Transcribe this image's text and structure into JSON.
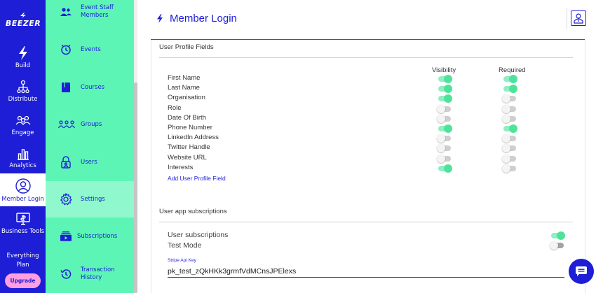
{
  "brand": {
    "logo_text": "BEEZER"
  },
  "rail": {
    "items": [
      {
        "label": "Build",
        "icon": "bolt-icon"
      },
      {
        "label": "Distribute",
        "icon": "distribute-icon"
      },
      {
        "label": "Engage",
        "icon": "engage-icon"
      },
      {
        "label": "Analytics",
        "icon": "analytics-icon"
      },
      {
        "label": "Member Login",
        "icon": "member-login-icon",
        "active": true
      },
      {
        "label": "Business Tools",
        "icon": "business-tools-icon"
      }
    ],
    "plan_line1": "Everything",
    "plan_line2": "Plan",
    "upgrade_label": "Upgrade"
  },
  "menu": {
    "items": [
      {
        "label": "Event Staff Members",
        "icon": "people-icon"
      },
      {
        "label": "Events",
        "icon": "clock-icon"
      },
      {
        "label": "Courses",
        "icon": "book-icon"
      },
      {
        "label": "Groups",
        "icon": "groups-icon"
      },
      {
        "label": "Users",
        "icon": "lock-user-icon"
      },
      {
        "label": "Settings",
        "icon": "gear-icon",
        "active": true
      },
      {
        "label": "Subscriptions",
        "icon": "subscriptions-icon"
      },
      {
        "label": "Transaction History",
        "icon": "history-icon"
      }
    ]
  },
  "header": {
    "title": "Member Login"
  },
  "profile_fields": {
    "section_title": "User Profile Fields",
    "col_visibility": "Visibility",
    "col_required": "Required",
    "fields": [
      {
        "label": "First Name",
        "visible": true,
        "required": true
      },
      {
        "label": "Last Name",
        "visible": true,
        "required": true
      },
      {
        "label": "Organisation",
        "visible": true,
        "required": false
      },
      {
        "label": "Role",
        "visible": false,
        "required": false
      },
      {
        "label": "Date Of Birth",
        "visible": false,
        "required": false
      },
      {
        "label": "Phone Number",
        "visible": true,
        "required": true
      },
      {
        "label": "LinkedIn Address",
        "visible": false,
        "required": false
      },
      {
        "label": "Twitter Handle",
        "visible": false,
        "required": false
      },
      {
        "label": "Website URL",
        "visible": false,
        "required": false
      },
      {
        "label": "Interests",
        "visible": true,
        "required": false
      }
    ],
    "add_field_label": "Add User Profile Field"
  },
  "subscriptions": {
    "section_title": "User app subscriptions",
    "user_subscriptions_label": "User subscriptions",
    "user_subscriptions_on": true,
    "test_mode_label": "Test Mode",
    "test_mode_on": false,
    "api_key_label": "Stripe Api Key",
    "api_key_value": "pk_test_zQkHKk3grmfVdMCnsJPElexs"
  },
  "colors": {
    "accent": "#1d1ed6",
    "menu_bg": "#5df5b6",
    "toggle_on": "#4ee39a",
    "upgrade": "#ff9ee0"
  }
}
